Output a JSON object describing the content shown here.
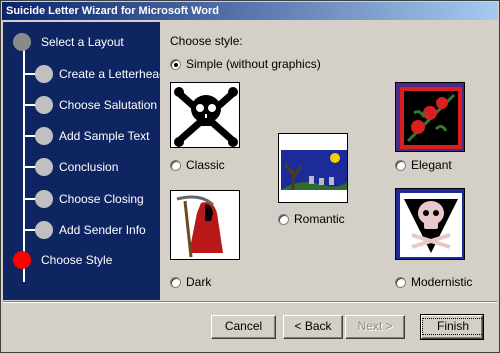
{
  "window": {
    "title": "Suicide Letter Wizard for Microsoft Word"
  },
  "steps": [
    {
      "label": "Select a Layout"
    },
    {
      "label": "Create a Letterhead"
    },
    {
      "label": "Choose Salutation"
    },
    {
      "label": "Add Sample Text"
    },
    {
      "label": "Conclusion"
    },
    {
      "label": "Choose Closing"
    },
    {
      "label": "Add Sender Info"
    },
    {
      "label": "Choose Style"
    }
  ],
  "main": {
    "heading": "Choose style:",
    "simple_option": "Simple (without graphics)",
    "styles": {
      "classic": "Classic",
      "romantic": "Romantic",
      "elegant": "Elegant",
      "dark": "Dark",
      "modernistic": "Modernistic"
    }
  },
  "buttons": {
    "cancel": "Cancel",
    "back": "< Back",
    "next": "Next >",
    "finish": "Finish"
  },
  "colors": {
    "sidebar_bg": "#0f2562",
    "active_step": "#ff0000",
    "pending_step": "#c0c0c0"
  }
}
